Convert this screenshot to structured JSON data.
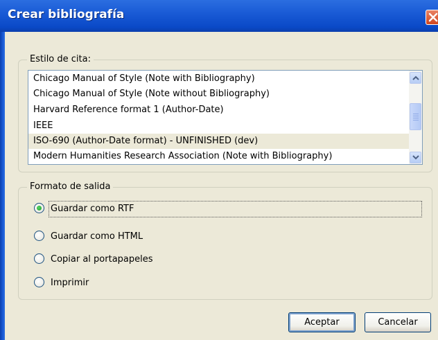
{
  "window": {
    "title": "Crear bibliografía"
  },
  "citation_style": {
    "legend": "Estilo de cita:",
    "items": [
      "Chicago Manual of Style (Note with Bibliography)",
      "Chicago Manual of Style (Note without Bibliography)",
      "Harvard Reference format 1 (Author-Date)",
      "IEEE",
      "ISO-690 (Author-Date format) - UNFINISHED  (dev)",
      "Modern Humanities Research Association (Note with Bibliography)"
    ],
    "selected_index": 4
  },
  "output_format": {
    "legend": "Formato de salida",
    "options": [
      {
        "label": "Guardar como RTF",
        "checked": true
      },
      {
        "label": "Guardar como HTML",
        "checked": false
      },
      {
        "label": "Copiar al portapapeles",
        "checked": false
      },
      {
        "label": "Imprimir",
        "checked": false
      }
    ]
  },
  "buttons": {
    "accept": "Aceptar",
    "cancel": "Cancelar"
  },
  "colors": {
    "titlebar": "#0a49c7",
    "dialog_bg": "#ece9d8",
    "selected_row": "#ece9d8",
    "radio_check": "#21a121"
  }
}
